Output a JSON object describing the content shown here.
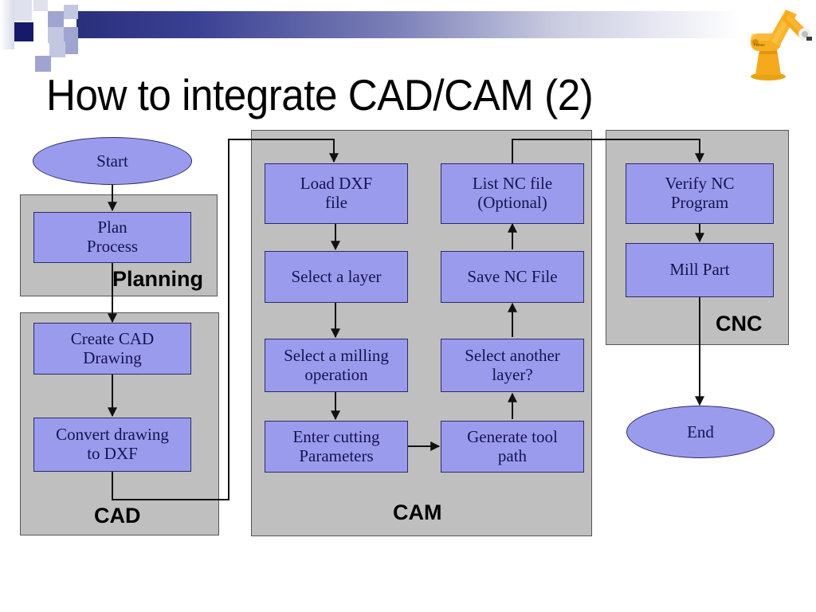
{
  "slide": {
    "title": "How to integrate CAD/CAM (2)",
    "decoration": {
      "robot_icon": "industrial-robot-arm-icon",
      "accent_dark": "#161a6b",
      "accent_mid": "#9fa5cf",
      "gradient_from": "#2a2f7c",
      "gradient_to": "#ffffff"
    }
  },
  "diagram": {
    "type": "flowchart",
    "node_fill": "#9b9bee",
    "node_border": "#2b2b66",
    "group_fill": "#bfbfbf",
    "groups": [
      {
        "id": "planning",
        "label": "Planning"
      },
      {
        "id": "cad",
        "label": "CAD"
      },
      {
        "id": "cam",
        "label": "CAM"
      },
      {
        "id": "cnc",
        "label": "CNC"
      }
    ],
    "terminals": [
      {
        "id": "start",
        "label": "Start"
      },
      {
        "id": "end",
        "label": "End"
      }
    ],
    "nodes": [
      {
        "id": "plan_process",
        "group": "planning",
        "label": "Plan\nProcess"
      },
      {
        "id": "create_cad",
        "group": "cad",
        "label": "Create CAD\nDrawing"
      },
      {
        "id": "convert_dxf",
        "group": "cad",
        "label": "Convert drawing\nto DXF"
      },
      {
        "id": "load_dxf",
        "group": "cam",
        "label": "Load DXF\nfile"
      },
      {
        "id": "select_layer",
        "group": "cam",
        "label": "Select a layer"
      },
      {
        "id": "select_milling",
        "group": "cam",
        "label": "Select a milling\noperation"
      },
      {
        "id": "enter_cutting",
        "group": "cam",
        "label": "Enter cutting\nParameters"
      },
      {
        "id": "generate_tool",
        "group": "cam",
        "label": "Generate tool\npath"
      },
      {
        "id": "select_another",
        "group": "cam",
        "label": "Select another\nlayer?"
      },
      {
        "id": "save_nc",
        "group": "cam",
        "label": "Save NC File"
      },
      {
        "id": "list_nc",
        "group": "cam",
        "label": "List NC file\n(Optional)"
      },
      {
        "id": "verify_nc",
        "group": "cnc",
        "label": "Verify NC\nProgram"
      },
      {
        "id": "mill_part",
        "group": "cnc",
        "label": "Mill Part"
      }
    ],
    "edges": [
      {
        "from": "start",
        "to": "plan_process"
      },
      {
        "from": "plan_process",
        "to": "create_cad"
      },
      {
        "from": "create_cad",
        "to": "convert_dxf"
      },
      {
        "from": "convert_dxf",
        "to": "load_dxf"
      },
      {
        "from": "load_dxf",
        "to": "select_layer"
      },
      {
        "from": "select_layer",
        "to": "select_milling"
      },
      {
        "from": "select_milling",
        "to": "enter_cutting"
      },
      {
        "from": "enter_cutting",
        "to": "generate_tool"
      },
      {
        "from": "generate_tool",
        "to": "select_another"
      },
      {
        "from": "select_another",
        "to": "save_nc"
      },
      {
        "from": "save_nc",
        "to": "list_nc"
      },
      {
        "from": "list_nc",
        "to": "verify_nc"
      },
      {
        "from": "verify_nc",
        "to": "mill_part"
      },
      {
        "from": "mill_part",
        "to": "end"
      }
    ]
  }
}
